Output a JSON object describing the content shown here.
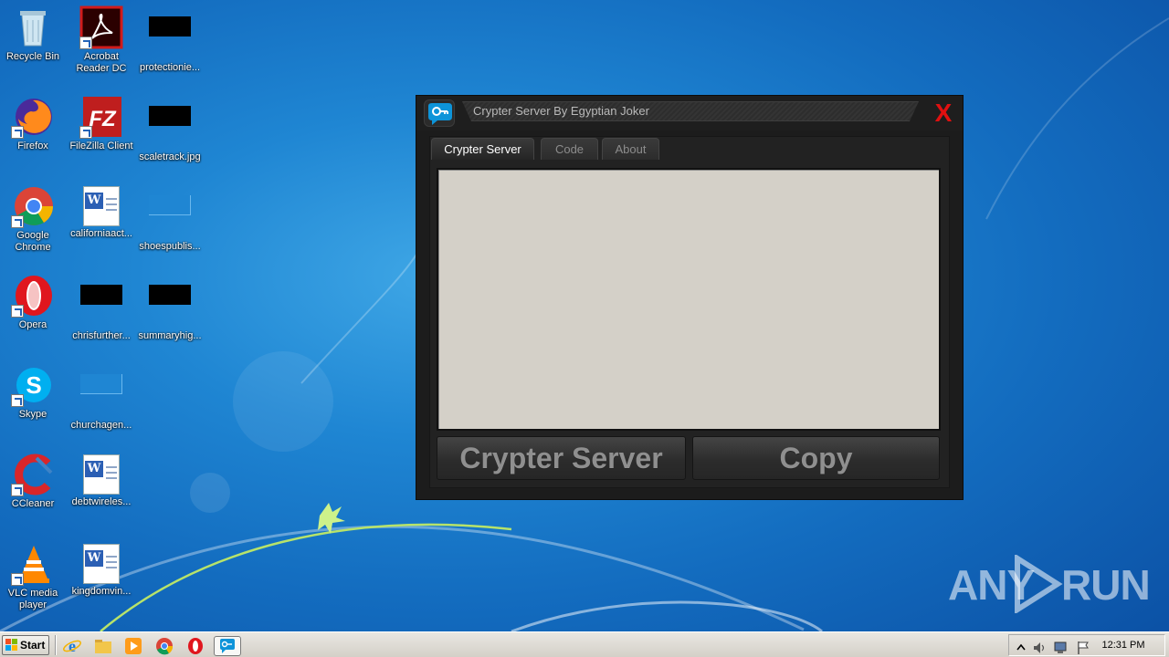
{
  "desktop": {
    "icons": [
      {
        "label": "Recycle Bin"
      },
      {
        "label": "Acrobat\nReader DC"
      },
      {
        "label": "protectionie..."
      },
      {
        "label": "Firefox"
      },
      {
        "label": "FileZilla Client"
      },
      {
        "label": "scaletrack.jpg"
      },
      {
        "label": "Google\nChrome"
      },
      {
        "label": "californiaact..."
      },
      {
        "label": "shoespublis..."
      },
      {
        "label": "Opera"
      },
      {
        "label": "chrisfurther..."
      },
      {
        "label": "summaryhig..."
      },
      {
        "label": "Skype"
      },
      {
        "label": "churchagen..."
      },
      {
        "label": "CCleaner"
      },
      {
        "label": "debtwireles..."
      },
      {
        "label": "VLC media\nplayer"
      },
      {
        "label": "kingdomvin..."
      }
    ]
  },
  "crypter_window": {
    "title": "Crypter Server By Egyptian Joker",
    "close_label": "X",
    "tabs": [
      {
        "label": "Crypter Server",
        "active": true
      },
      {
        "label": "Code",
        "active": false
      },
      {
        "label": "About",
        "active": false
      }
    ],
    "output_value": "",
    "buttons": {
      "crypter_server": "Crypter Server",
      "copy": "Copy"
    }
  },
  "watermark": {
    "left": "ANY",
    "right": "RUN"
  },
  "taskbar": {
    "start_label": "Start",
    "quick_launch": [
      "ie-icon",
      "explorer-icon",
      "media-player-icon",
      "chrome-icon",
      "opera-icon",
      "crypter-app-icon"
    ],
    "clock": "12:31 PM"
  },
  "colors": {
    "close": "#e01010",
    "text_area": "#d4d0c8",
    "window_bg": "#1c1c1c"
  }
}
